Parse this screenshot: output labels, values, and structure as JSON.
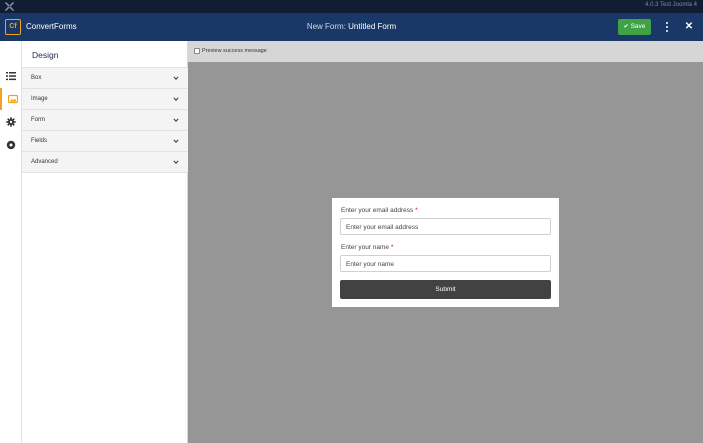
{
  "system_bar": {
    "version": "4.0.3 Test Joomla 4",
    "logo_icon": "joomla-icon"
  },
  "header": {
    "logo_text": "Cf",
    "app_name": "ConvertForms",
    "form_title_prefix": "New Form: ",
    "form_title_name": "Untitled Form",
    "save_label": "Save",
    "save_color": "#3fa244",
    "brand_color": "#1a3867",
    "accent_color": "#f0a41c"
  },
  "rail": {
    "items": [
      {
        "icon": "list-icon",
        "active": false
      },
      {
        "icon": "design-icon",
        "active": true
      },
      {
        "icon": "gear-icon",
        "active": false
      },
      {
        "icon": "circle-dot-icon",
        "active": false
      }
    ]
  },
  "panel": {
    "title": "Design",
    "items": [
      {
        "label": "Box"
      },
      {
        "label": "Image"
      },
      {
        "label": "Form"
      },
      {
        "label": "Fields"
      },
      {
        "label": "Advanced"
      }
    ]
  },
  "preview": {
    "checkbox_label": "Preview success message",
    "checked": false
  },
  "form": {
    "fields": [
      {
        "label": "Enter your email address",
        "required_mark": "*",
        "placeholder": "Enter your email address"
      },
      {
        "label": "Enter your name",
        "required_mark": "*",
        "placeholder": "Enter your name"
      }
    ],
    "submit_label": "Submit"
  }
}
